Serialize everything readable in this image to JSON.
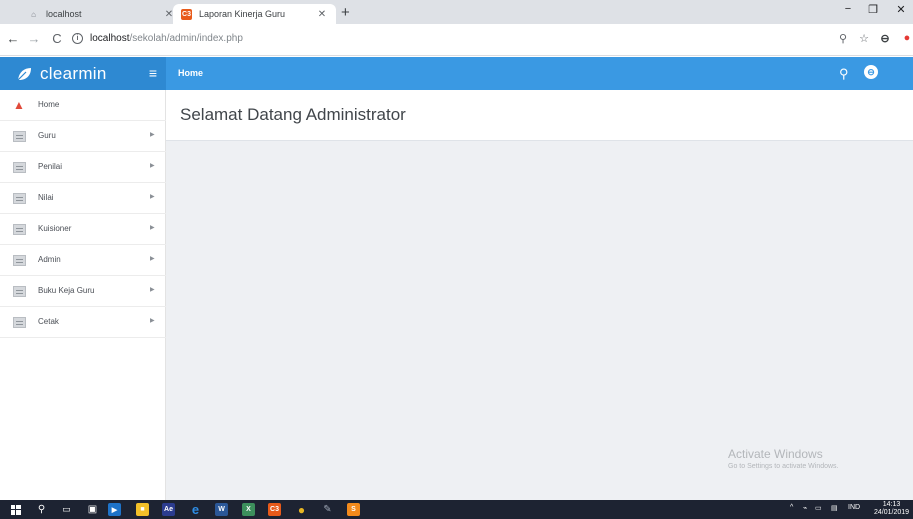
{
  "browser": {
    "tabs": [
      {
        "title": "localhost",
        "favicon": "folder-icon"
      },
      {
        "title": "Laporan Kinerja Guru",
        "favicon": "app-favicon",
        "favicon_text": "C3"
      }
    ],
    "new_tab": "+",
    "window_controls": {
      "minimize": "−",
      "maximize": "❐",
      "close": "✕"
    },
    "nav": {
      "back": "←",
      "forward": "→",
      "reload": "C"
    },
    "url_host": "localhost",
    "url_path": "/sekolah/admin/index.php"
  },
  "app": {
    "brand": "clearmin",
    "menu_toggle": "≡",
    "breadcrumb": "Home",
    "accent_color": "#3a99e3"
  },
  "sidebar": {
    "items": [
      {
        "label": "Home",
        "icon": "home-icon",
        "has_submenu": false
      },
      {
        "label": "Guru",
        "icon": "document-icon",
        "has_submenu": true
      },
      {
        "label": "Penilai",
        "icon": "document-icon",
        "has_submenu": true
      },
      {
        "label": "Nilai",
        "icon": "document-icon",
        "has_submenu": true
      },
      {
        "label": "Kuisioner",
        "icon": "document-icon",
        "has_submenu": true
      },
      {
        "label": "Admin",
        "icon": "document-icon",
        "has_submenu": true
      },
      {
        "label": "Buku Keja Guru",
        "icon": "document-icon",
        "has_submenu": true
      },
      {
        "label": "Cetak",
        "icon": "document-icon",
        "has_submenu": true
      }
    ]
  },
  "main": {
    "welcome_title": "Selamat Datang Administrator"
  },
  "watermark": {
    "title": "Activate Windows",
    "subtitle": "Go to Settings to activate Windows."
  },
  "taskbar": {
    "tray_lang": "IND",
    "time": "14:13",
    "date": "24/01/2019"
  }
}
